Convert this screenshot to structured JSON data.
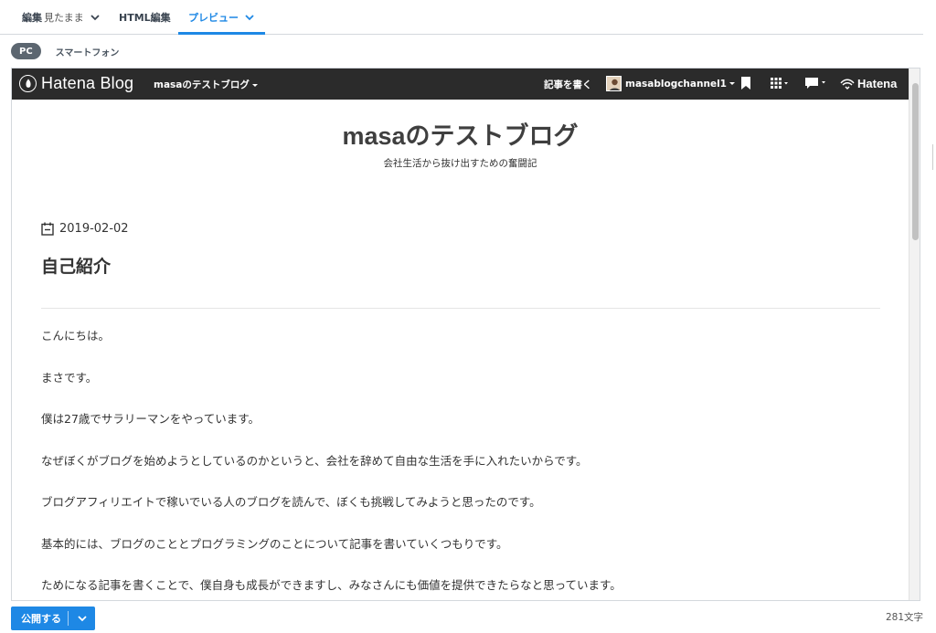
{
  "editor_tabs": {
    "edit_label": "編集",
    "edit_mode": "見たまま",
    "html_label": "HTML編集",
    "preview_label": "プレビュー"
  },
  "device_toggle": {
    "pc": "PC",
    "smartphone": "スマートフォン"
  },
  "hatena_bar": {
    "logo_text": "Hatena Blog",
    "blog_menu": "masaのテストブログ",
    "write_link": "記事を書く",
    "username": "masablogchannel1",
    "brand": "Hatena"
  },
  "blog": {
    "title": "masaのテストブログ",
    "description": "会社生活から抜け出すための奮闘記"
  },
  "entry": {
    "date": "2019-02-02",
    "title": "自己紹介",
    "paragraphs": [
      "こんにちは。",
      "まさです。",
      "僕は27歳でサラリーマンをやっています。",
      "なぜぼくがブログを始めようとしているのかというと、会社を辞めて自由な生活を手に入れたいからです。",
      "ブログアフィリエイトで稼いでいる人のブログを読んで、ぼくも挑戦してみようと思ったのです。",
      "基本的には、ブログのこととプログラミングのことについて記事を書いていくつもりです。",
      "ためになる記事を書くことで、僕自身も成長ができますし、みなさんにも価値を提供できたらなと思っています。"
    ]
  },
  "footer": {
    "publish_label": "公開する",
    "char_count": "281文字"
  },
  "colors": {
    "accent": "#1e88e5",
    "hatena_bar": "#2b2b2b",
    "pc_pill": "#5c6670"
  }
}
